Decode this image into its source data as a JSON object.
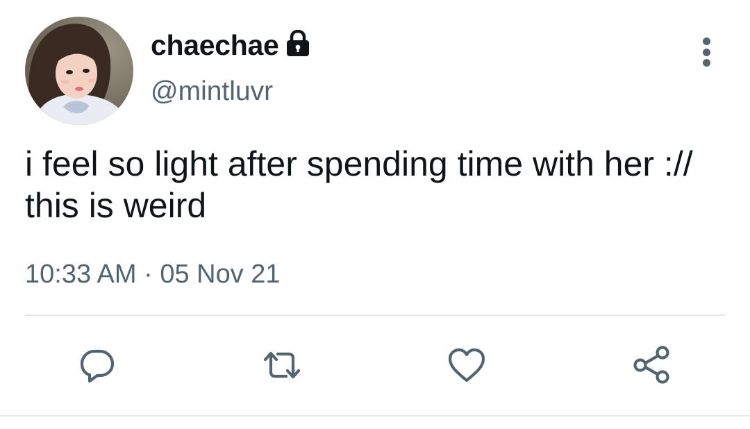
{
  "tweet": {
    "display_name": "chaechae",
    "handle": "@mintluvr",
    "text": "i feel so light after spending time with her :// this is weird",
    "time": "10:33 AM",
    "separator": " · ",
    "date": "05 Nov 21",
    "protected": true
  },
  "icons": {
    "avatar": "avatar-photo",
    "lock": "lock-icon",
    "more": "more-vertical-icon",
    "reply": "reply-icon",
    "retweet": "retweet-icon",
    "like": "heart-icon",
    "share": "share-icon"
  },
  "colors": {
    "text_primary": "#0f1419",
    "text_secondary": "#536471",
    "divider": "#e3e7ea"
  }
}
